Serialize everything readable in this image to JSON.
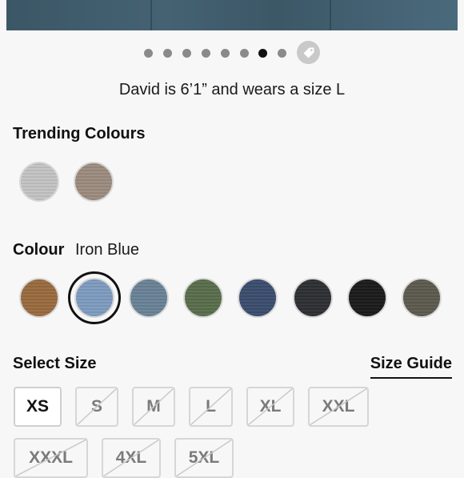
{
  "gallery": {
    "dots": [
      {
        "active": false
      },
      {
        "active": false
      },
      {
        "active": false
      },
      {
        "active": false
      },
      {
        "active": false
      },
      {
        "active": false
      },
      {
        "active": true
      },
      {
        "active": false
      }
    ],
    "tag_icon": "tag-icon"
  },
  "caption": "David is 6’1” and wears a size L",
  "trending": {
    "title": "Trending Colours",
    "swatches": [
      {
        "color": "#c4c4c4"
      },
      {
        "color": "#9d8c7f"
      }
    ]
  },
  "colour": {
    "title": "Colour",
    "selected": "Iron Blue",
    "swatches": [
      {
        "color": "#9a6b40",
        "selected": false
      },
      {
        "color": "#7e9cc0",
        "selected": true
      },
      {
        "color": "#6a8397",
        "selected": false
      },
      {
        "color": "#596f4c",
        "selected": false
      },
      {
        "color": "#3b4e6e",
        "selected": false
      },
      {
        "color": "#2f3033",
        "selected": false
      },
      {
        "color": "#1b1b1c",
        "selected": false
      },
      {
        "color": "#5d5a4f",
        "selected": false
      }
    ]
  },
  "size": {
    "title": "Select Size",
    "guide_label": "Size Guide",
    "options": [
      {
        "label": "XS",
        "available": true
      },
      {
        "label": "S",
        "available": false
      },
      {
        "label": "M",
        "available": false
      },
      {
        "label": "L",
        "available": false
      },
      {
        "label": "XL",
        "available": false
      },
      {
        "label": "XXL",
        "available": false
      },
      {
        "label": "XXXL",
        "available": false
      },
      {
        "label": "4XL",
        "available": false
      },
      {
        "label": "5XL",
        "available": false
      }
    ]
  }
}
